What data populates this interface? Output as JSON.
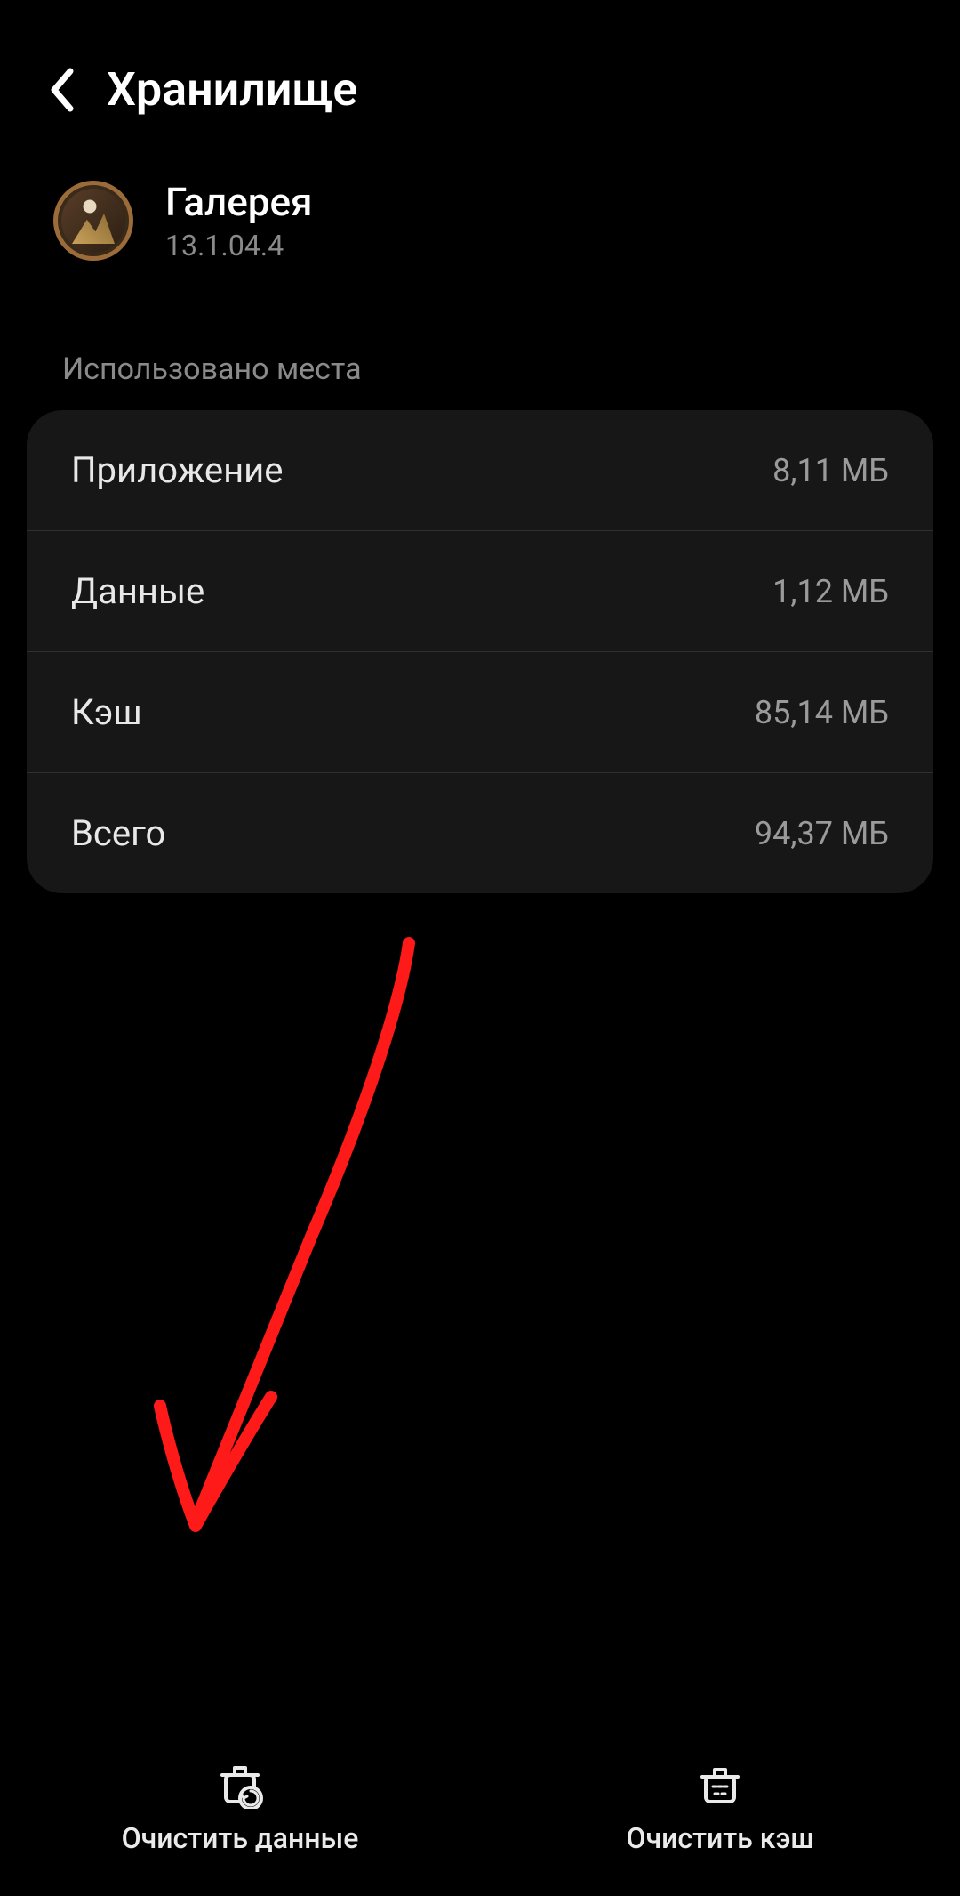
{
  "header": {
    "title": "Хранилище"
  },
  "app": {
    "name": "Галерея",
    "version": "13.1.04.4"
  },
  "section": {
    "space_used_label": "Использовано места"
  },
  "rows": {
    "app_label": "Приложение",
    "app_value": "8,11 МБ",
    "data_label": "Данные",
    "data_value": "1,12 МБ",
    "cache_label": "Кэш",
    "cache_value": "85,14 МБ",
    "total_label": "Всего",
    "total_value": "94,37 МБ"
  },
  "bottom": {
    "clear_data": "Очистить данные",
    "clear_cache": "Очистить кэш"
  },
  "annotation": {
    "color": "#ff1a1a"
  }
}
